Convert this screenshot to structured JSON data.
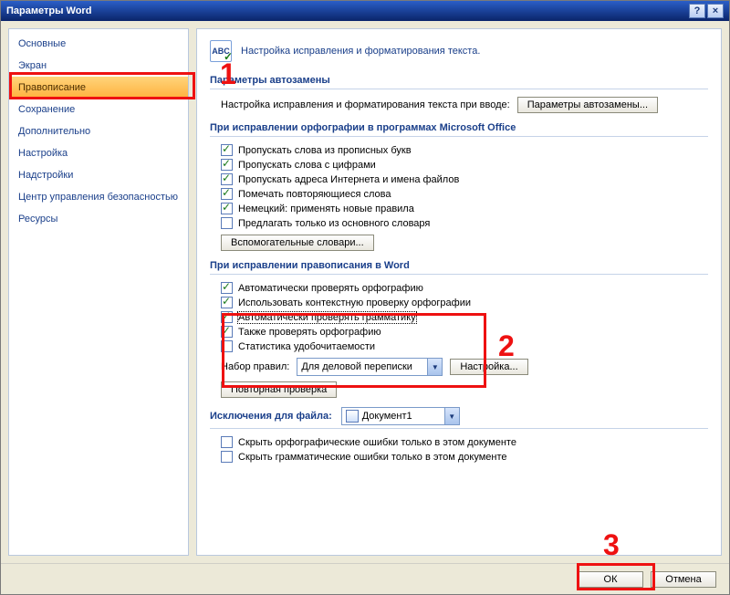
{
  "window_title": "Параметры Word",
  "titlebar": {
    "help": "?",
    "close": "×"
  },
  "sidebar": {
    "items": [
      {
        "label": "Основные"
      },
      {
        "label": "Экран"
      },
      {
        "label": "Правописание",
        "selected": true
      },
      {
        "label": "Сохранение"
      },
      {
        "label": "Дополнительно"
      },
      {
        "label": "Настройка"
      },
      {
        "label": "Надстройки"
      },
      {
        "label": "Центр управления безопасностью"
      },
      {
        "label": "Ресурсы"
      }
    ]
  },
  "header": {
    "icon_text": "ABC",
    "text": "Настройка исправления и форматирования текста."
  },
  "sections": {
    "autocorrect": {
      "title": "Параметры автозамены",
      "desc": "Настройка исправления и форматирования текста при вводе:",
      "button": "Параметры автозамены..."
    },
    "spelling_office": {
      "title": "При исправлении орфографии в программах Microsoft Office",
      "checks": [
        {
          "label": "Пропускать слова из прописных букв",
          "checked": true
        },
        {
          "label": "Пропускать слова с цифрами",
          "checked": true
        },
        {
          "label": "Пропускать адреса Интернета и имена файлов",
          "checked": true
        },
        {
          "label": "Помечать повторяющиеся слова",
          "checked": true
        },
        {
          "label": "Немецкий: применять новые правила",
          "checked": true
        },
        {
          "label": "Предлагать только из основного словаря",
          "checked": false
        }
      ],
      "dict_button": "Вспомогательные словари..."
    },
    "spelling_word": {
      "title": "При исправлении правописания в Word",
      "checks": [
        {
          "label": "Автоматически проверять орфографию",
          "checked": true
        },
        {
          "label": "Использовать контекстную проверку орфографии",
          "checked": true
        },
        {
          "label": "Автоматически проверять грамматику",
          "checked": true,
          "focused": true
        },
        {
          "label": "Также проверять орфографию",
          "checked": true
        },
        {
          "label": "Статистика удобочитаемости",
          "checked": false
        }
      ],
      "ruleset_label": "Набор правил:",
      "ruleset_value": "Для деловой переписки",
      "settings_button": "Настройка...",
      "recheck_button": "Повторная проверка"
    },
    "exceptions": {
      "title": "Исключения для файла:",
      "file_value": "Документ1",
      "checks": [
        {
          "label": "Скрыть орфографические ошибки только в этом документе",
          "checked": false
        },
        {
          "label": "Скрыть грамматические ошибки только в этом документе",
          "checked": false
        }
      ]
    }
  },
  "footer": {
    "ok": "ОК",
    "cancel": "Отмена"
  },
  "annotations": {
    "n1": "1",
    "n2": "2",
    "n3": "3"
  }
}
